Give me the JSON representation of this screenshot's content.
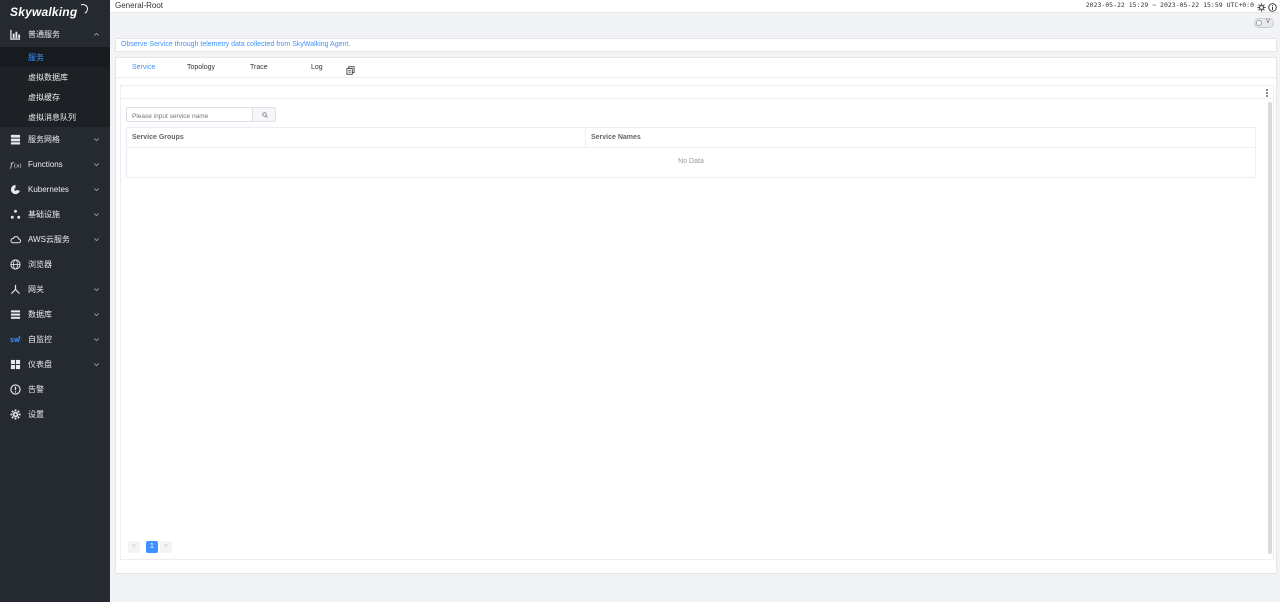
{
  "brand": {
    "logo_text": "Skywalking"
  },
  "sidebar": {
    "groups": [
      {
        "label": "普通服务",
        "icon": "chart-icon",
        "expanded": true,
        "has_chevron": true,
        "children": [
          {
            "label": "服务",
            "active": true
          },
          {
            "label": "虚拟数据库",
            "active": false
          },
          {
            "label": "虚拟缓存",
            "active": false
          },
          {
            "label": "虚拟消息队列",
            "active": false
          }
        ]
      },
      {
        "label": "服务网格",
        "icon": "server-stack-icon",
        "has_chevron": true
      },
      {
        "label": "Functions",
        "icon": "function-icon",
        "has_chevron": true
      },
      {
        "label": "Kubernetes",
        "icon": "kubernetes-icon",
        "has_chevron": true
      },
      {
        "label": "基础设施",
        "icon": "nodes-icon",
        "has_chevron": true
      },
      {
        "label": "AWS云服务",
        "icon": "cloud-icon",
        "has_chevron": true
      },
      {
        "label": "浏览器",
        "icon": "globe-icon",
        "has_chevron": false
      },
      {
        "label": "网关",
        "icon": "gateway-icon",
        "has_chevron": true
      },
      {
        "label": "数据库",
        "icon": "database-icon",
        "has_chevron": true
      },
      {
        "label": "自监控",
        "icon": "self-monitor-icon",
        "has_chevron": true
      },
      {
        "label": "仪表盘",
        "icon": "dashboard-icon",
        "has_chevron": true
      },
      {
        "label": "告警",
        "icon": "alert-icon",
        "has_chevron": false
      },
      {
        "label": "设置",
        "icon": "gear-icon",
        "has_chevron": false
      }
    ]
  },
  "header": {
    "breadcrumb": "General-Root",
    "time_range": "2023-05-22 15:29 ~ 2023-05-22 15:59",
    "timezone": "UTC+0:0",
    "toggle_label": "V"
  },
  "info": {
    "text": "Observe Service through telemetry data collected from SkyWalking Agent."
  },
  "tabs": [
    {
      "label": "Service",
      "active": true
    },
    {
      "label": "Topology",
      "active": false
    },
    {
      "label": "Trace",
      "active": false
    },
    {
      "label": "Log",
      "active": false
    }
  ],
  "service_list": {
    "search_placeholder": "Please input service name",
    "columns": [
      "Service Groups",
      "Service Names"
    ],
    "empty_text": "No Data",
    "pagination": {
      "current_page": "1",
      "prev": "<",
      "next": ">"
    }
  },
  "colors": {
    "accent": "#3d92ff",
    "sidebar_bg": "#252a30"
  }
}
